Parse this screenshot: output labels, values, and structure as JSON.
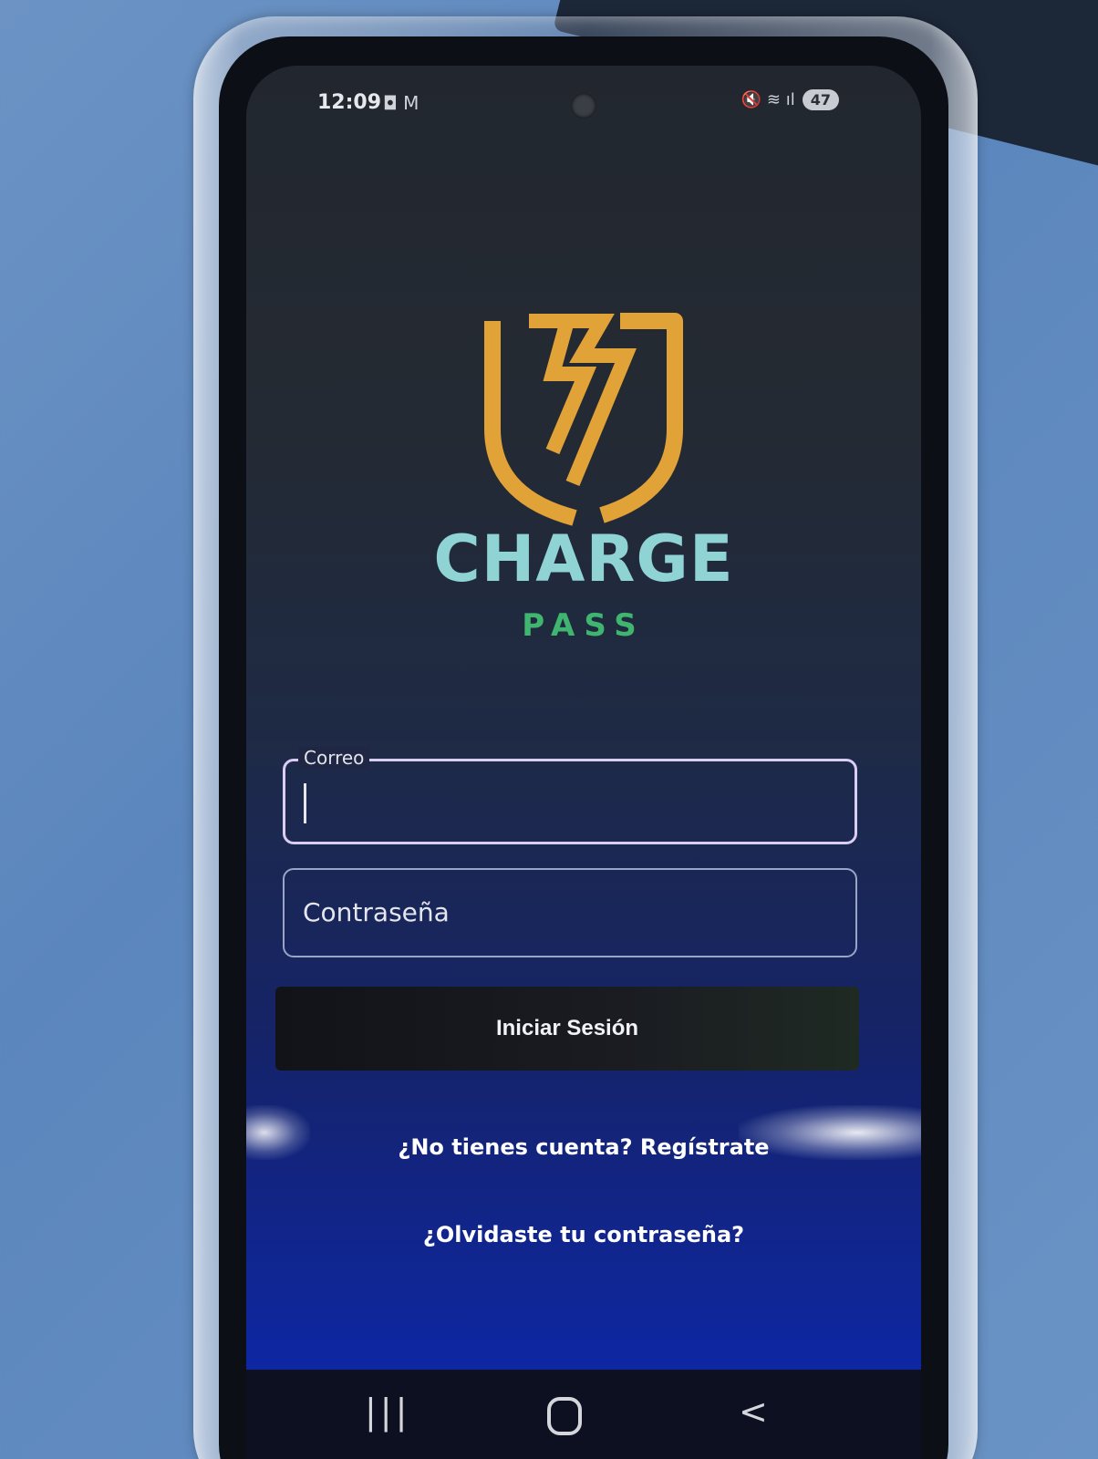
{
  "status_bar": {
    "time": "12:09",
    "left_icons": "◘ M",
    "right_icons": "🔇 ≋ ıl",
    "battery": "47"
  },
  "brand": {
    "title": "CHARGE",
    "subtitle": "PASS",
    "colors": {
      "logo": "#e1a237",
      "title": "#8fd3d5",
      "subtitle": "#3fb56f"
    }
  },
  "login_form": {
    "email_label": "Correo",
    "email_value": "",
    "password_placeholder": "Contraseña",
    "submit_label": "Iniciar Sesión"
  },
  "links": {
    "register": "¿No tienes cuenta? Regístrate",
    "forgot_password": "¿Olvidaste tu contraseña?"
  },
  "nav_bar": {
    "recent_icon": "recent-apps-icon",
    "home_icon": "home-icon",
    "back_icon": "back-icon",
    "recent_glyph": "|||",
    "back_glyph": "<"
  }
}
